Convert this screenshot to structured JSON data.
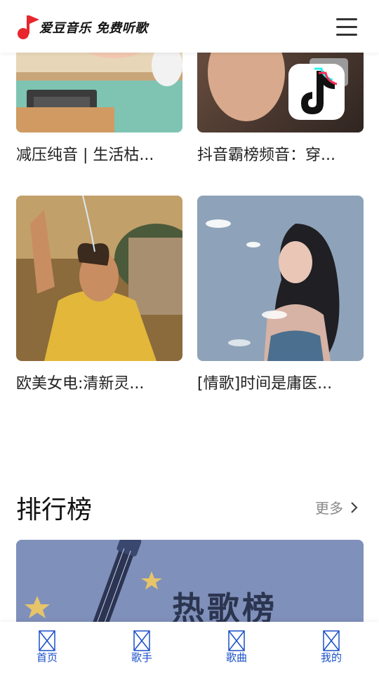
{
  "header": {
    "logo_text": "爱豆音乐 免费听歌",
    "menu_icon": "hamburger-menu-icon"
  },
  "playlists": [
    {
      "title": "减压纯音 | 生活枯..."
    },
    {
      "title": "抖音霸榜频音：穿..."
    },
    {
      "title": "欧美女电:清新灵..."
    },
    {
      "title": "[情歌]时间是庸医..."
    }
  ],
  "ranking": {
    "section_title": "排行榜",
    "more_label": "更多",
    "banner_title": "热歌榜"
  },
  "tabbar": {
    "items": [
      {
        "label": "首页",
        "icon": "broken-image-icon"
      },
      {
        "label": "歌手",
        "icon": "broken-image-icon"
      },
      {
        "label": "歌曲",
        "icon": "broken-image-icon"
      },
      {
        "label": "我的",
        "icon": "broken-image-icon"
      }
    ]
  },
  "colors": {
    "accent_red": "#e8262d",
    "tab_text": "#1a4fc9",
    "muted": "#888888"
  }
}
